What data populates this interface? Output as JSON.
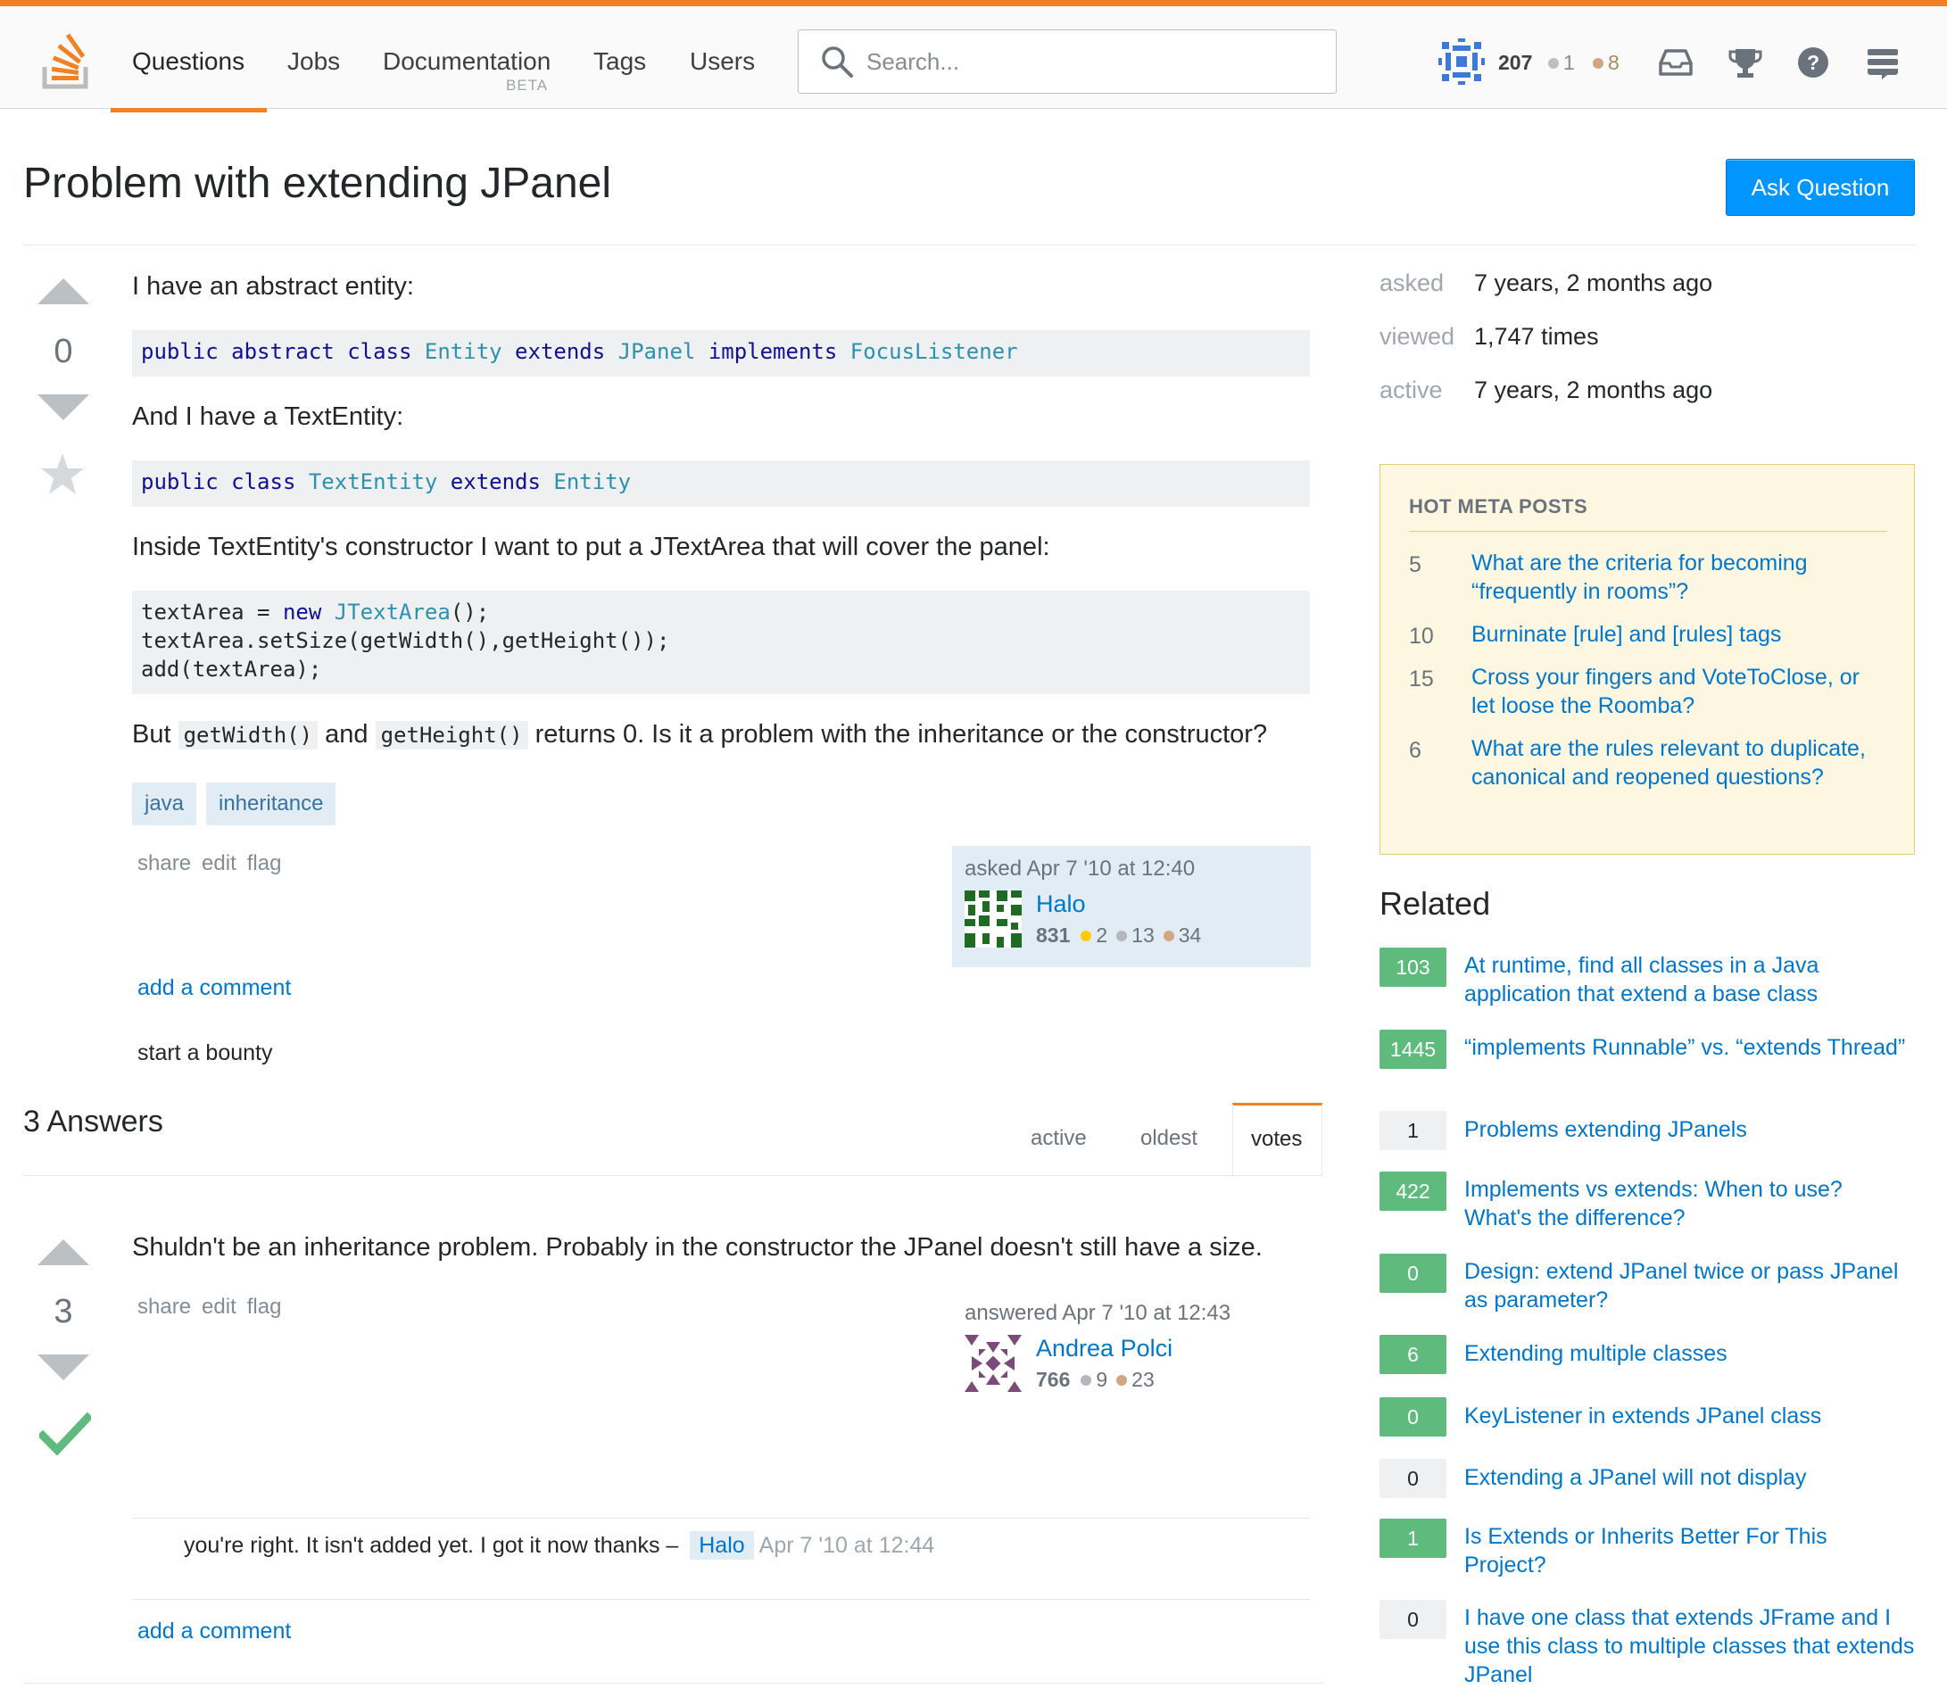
{
  "topbar": {
    "nav": [
      {
        "label": "Questions"
      },
      {
        "label": "Jobs"
      },
      {
        "label": "Documentation"
      },
      {
        "label": "Tags"
      },
      {
        "label": "Users"
      }
    ],
    "beta_label": "BETA",
    "search_placeholder": "Search...",
    "user": {
      "reputation": "207",
      "silver": "1",
      "bronze": "8"
    }
  },
  "question": {
    "title": "Problem with extending JPanel",
    "ask_button": "Ask Question",
    "score": "0",
    "body": {
      "p1": "I have an abstract entity:",
      "p2": "And I have a TextEntity:",
      "p3": "Inside TextEntity's constructor I want to put a JTextArea that will cover the panel:",
      "p4_pre": "But",
      "p4_code1": "getWidth()",
      "p4_and": "and",
      "p4_code2": "getHeight()",
      "p4_post": "returns 0. Is it a problem with the inheritance or the constructor?"
    },
    "tags": [
      "java",
      "inheritance"
    ],
    "menu": {
      "share": "share",
      "edit": "edit",
      "flag": "flag"
    },
    "owner": {
      "asked": "asked Apr 7 '10 at 12:40",
      "name": "Halo",
      "reputation": "831",
      "gold": "2",
      "silver": "13",
      "bronze": "34"
    },
    "add_comment": "add a comment",
    "bounty": "start a bounty"
  },
  "answers": {
    "count_label": "3 Answers",
    "sort_tabs": [
      {
        "label": "active"
      },
      {
        "label": "oldest"
      },
      {
        "label": "votes"
      }
    ],
    "first": {
      "score": "3",
      "body": "Shuldn't be an inheritance problem. Probably in the constructor the JPanel doesn't still have a size.",
      "menu": {
        "share": "share",
        "edit": "edit",
        "flag": "flag"
      },
      "author": {
        "answered": "answered Apr 7 '10 at 12:43",
        "name": "Andrea Polci",
        "reputation": "766",
        "silver": "9",
        "bronze": "23"
      },
      "comment": {
        "text": "you're right. It isn't added yet. I got it now thanks –",
        "user": "Halo",
        "time": "Apr 7 '10 at 12:44"
      },
      "add_comment": "add a comment"
    }
  },
  "sidebar": {
    "stats": [
      {
        "label": "asked",
        "value": "7 years, 2 months ago"
      },
      {
        "label": "viewed",
        "value": "1,747 times"
      },
      {
        "label": "active",
        "value": "7 years, 2 months ago"
      }
    ],
    "meta": {
      "title": "HOT META POSTS",
      "items": [
        {
          "num": "5",
          "text": "What are the criteria for becoming “frequently in rooms”?"
        },
        {
          "num": "10",
          "text": "Burninate [rule] and [rules] tags"
        },
        {
          "num": "15",
          "text": "Cross your fingers and VoteToClose, or let loose the Roomba?"
        },
        {
          "num": "6",
          "text": "What are the rules relevant to duplicate, canonical and reopened questions?"
        }
      ]
    },
    "related_title": "Related",
    "related": [
      {
        "score": "103",
        "text": "At runtime, find all classes in a Java application that extend a base class"
      },
      {
        "score": "1445",
        "text": "“implements Runnable” vs. “extends Thread”"
      },
      {
        "score": "1",
        "text": "Problems extending JPanels"
      },
      {
        "score": "422",
        "text": "Implements vs extends: When to use? What's the difference?"
      },
      {
        "score": "0",
        "text": "Design: extend JPanel twice or pass JPanel as parameter?"
      },
      {
        "score": "6",
        "text": "Extending multiple classes"
      },
      {
        "score": "0",
        "text": "KeyListener in extends JPanel class"
      },
      {
        "score": "0",
        "text": "Extending a JPanel will not display"
      },
      {
        "score": "1",
        "text": "Is Extends or Inherits Better For This Project?"
      },
      {
        "score": "0",
        "text": "I have one class that extends JFrame and I use this class to multiple classes that extends JPanel"
      }
    ]
  }
}
